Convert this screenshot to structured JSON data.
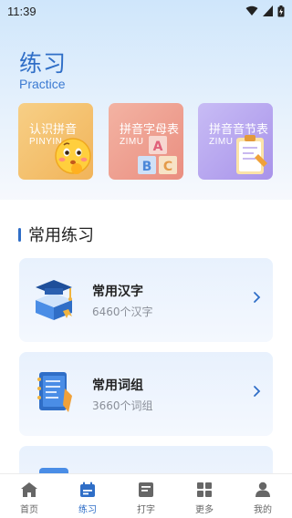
{
  "status_bar": {
    "time": "11:39"
  },
  "header": {
    "title": "练习",
    "subtitle": "Practice"
  },
  "categories": [
    {
      "title": "认识拼音",
      "sub": "PINYIN",
      "color": "#f4c06a"
    },
    {
      "title": "拼音字母表",
      "sub": "ZIMU",
      "color": "#f0a593"
    },
    {
      "title": "拼音音节表",
      "sub": "ZIMU",
      "color": "#b9a9ef"
    }
  ],
  "section": {
    "title": "常用练习"
  },
  "practice_items": [
    {
      "name": "常用汉字",
      "count": "6460个汉字"
    },
    {
      "name": "常用词组",
      "count": "3660个词组"
    },
    {
      "name": "",
      "count": ""
    }
  ],
  "tabbar": {
    "items": [
      {
        "label": "首页",
        "icon": "home-icon",
        "active": false
      },
      {
        "label": "练习",
        "icon": "calendar-icon",
        "active": true
      },
      {
        "label": "打字",
        "icon": "document-icon",
        "active": false
      },
      {
        "label": "更多",
        "icon": "grid-icon",
        "active": false
      },
      {
        "label": "我的",
        "icon": "person-icon",
        "active": false
      }
    ]
  },
  "colors": {
    "accent": "#2f6ec7",
    "tab_inactive": "#666666"
  }
}
